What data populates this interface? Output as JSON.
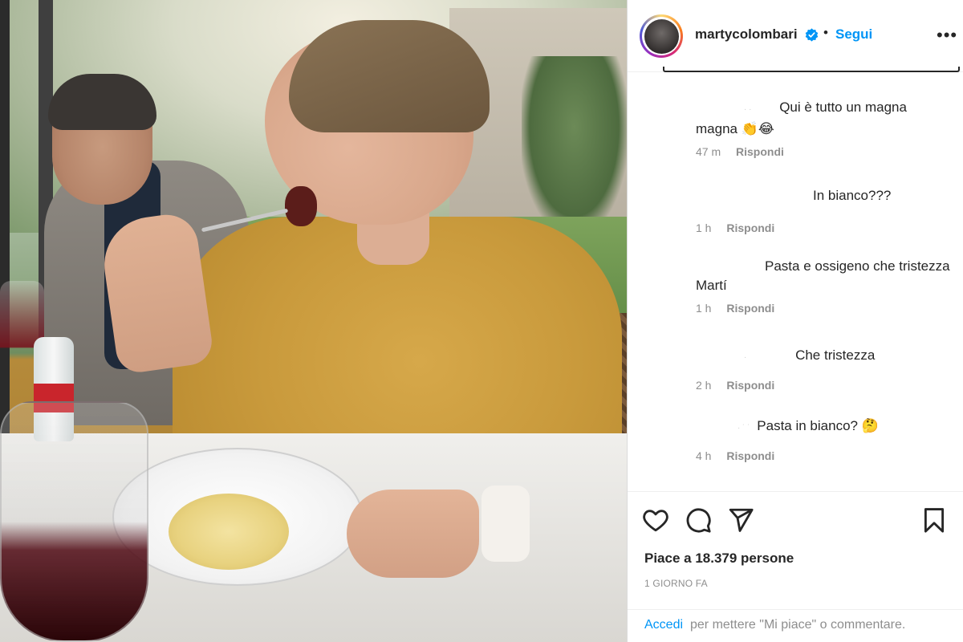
{
  "post": {
    "username": "martycolombari",
    "follow_label": "Segui",
    "more_label": "•••",
    "separator": "•"
  },
  "comments": [
    {
      "text_line1": "Qui è tutto un magna",
      "text_line2": "magna 👏😂",
      "time": "47 m",
      "reply": "Rispondi"
    },
    {
      "text_line1": "In bianco???",
      "time": "1 h",
      "reply": "Rispondi"
    },
    {
      "text_line1": "Pasta e ossigeno che tristezza",
      "text_line2": "Martí",
      "time": "1 h",
      "reply": "Rispondi"
    },
    {
      "text_line1": "Che tristezza",
      "time": "2 h",
      "reply": "Rispondi"
    },
    {
      "text_line1": "Pasta in bianco? 🤔",
      "time": "4 h",
      "reply": "Rispondi"
    }
  ],
  "footer": {
    "likes": "Piace a 18.379 persone",
    "date": "1 GIORNO FA",
    "login_link": "Accedi",
    "login_rest": "per mettere \"Mi piace\" o commentare."
  },
  "icons": {
    "like": "heart-icon",
    "comment": "comment-icon",
    "share": "share-icon",
    "save": "bookmark-icon",
    "verified": "verified-badge-icon"
  },
  "colors": {
    "link_blue": "#0095f6",
    "text": "#262626",
    "muted": "#8e8e8e"
  }
}
